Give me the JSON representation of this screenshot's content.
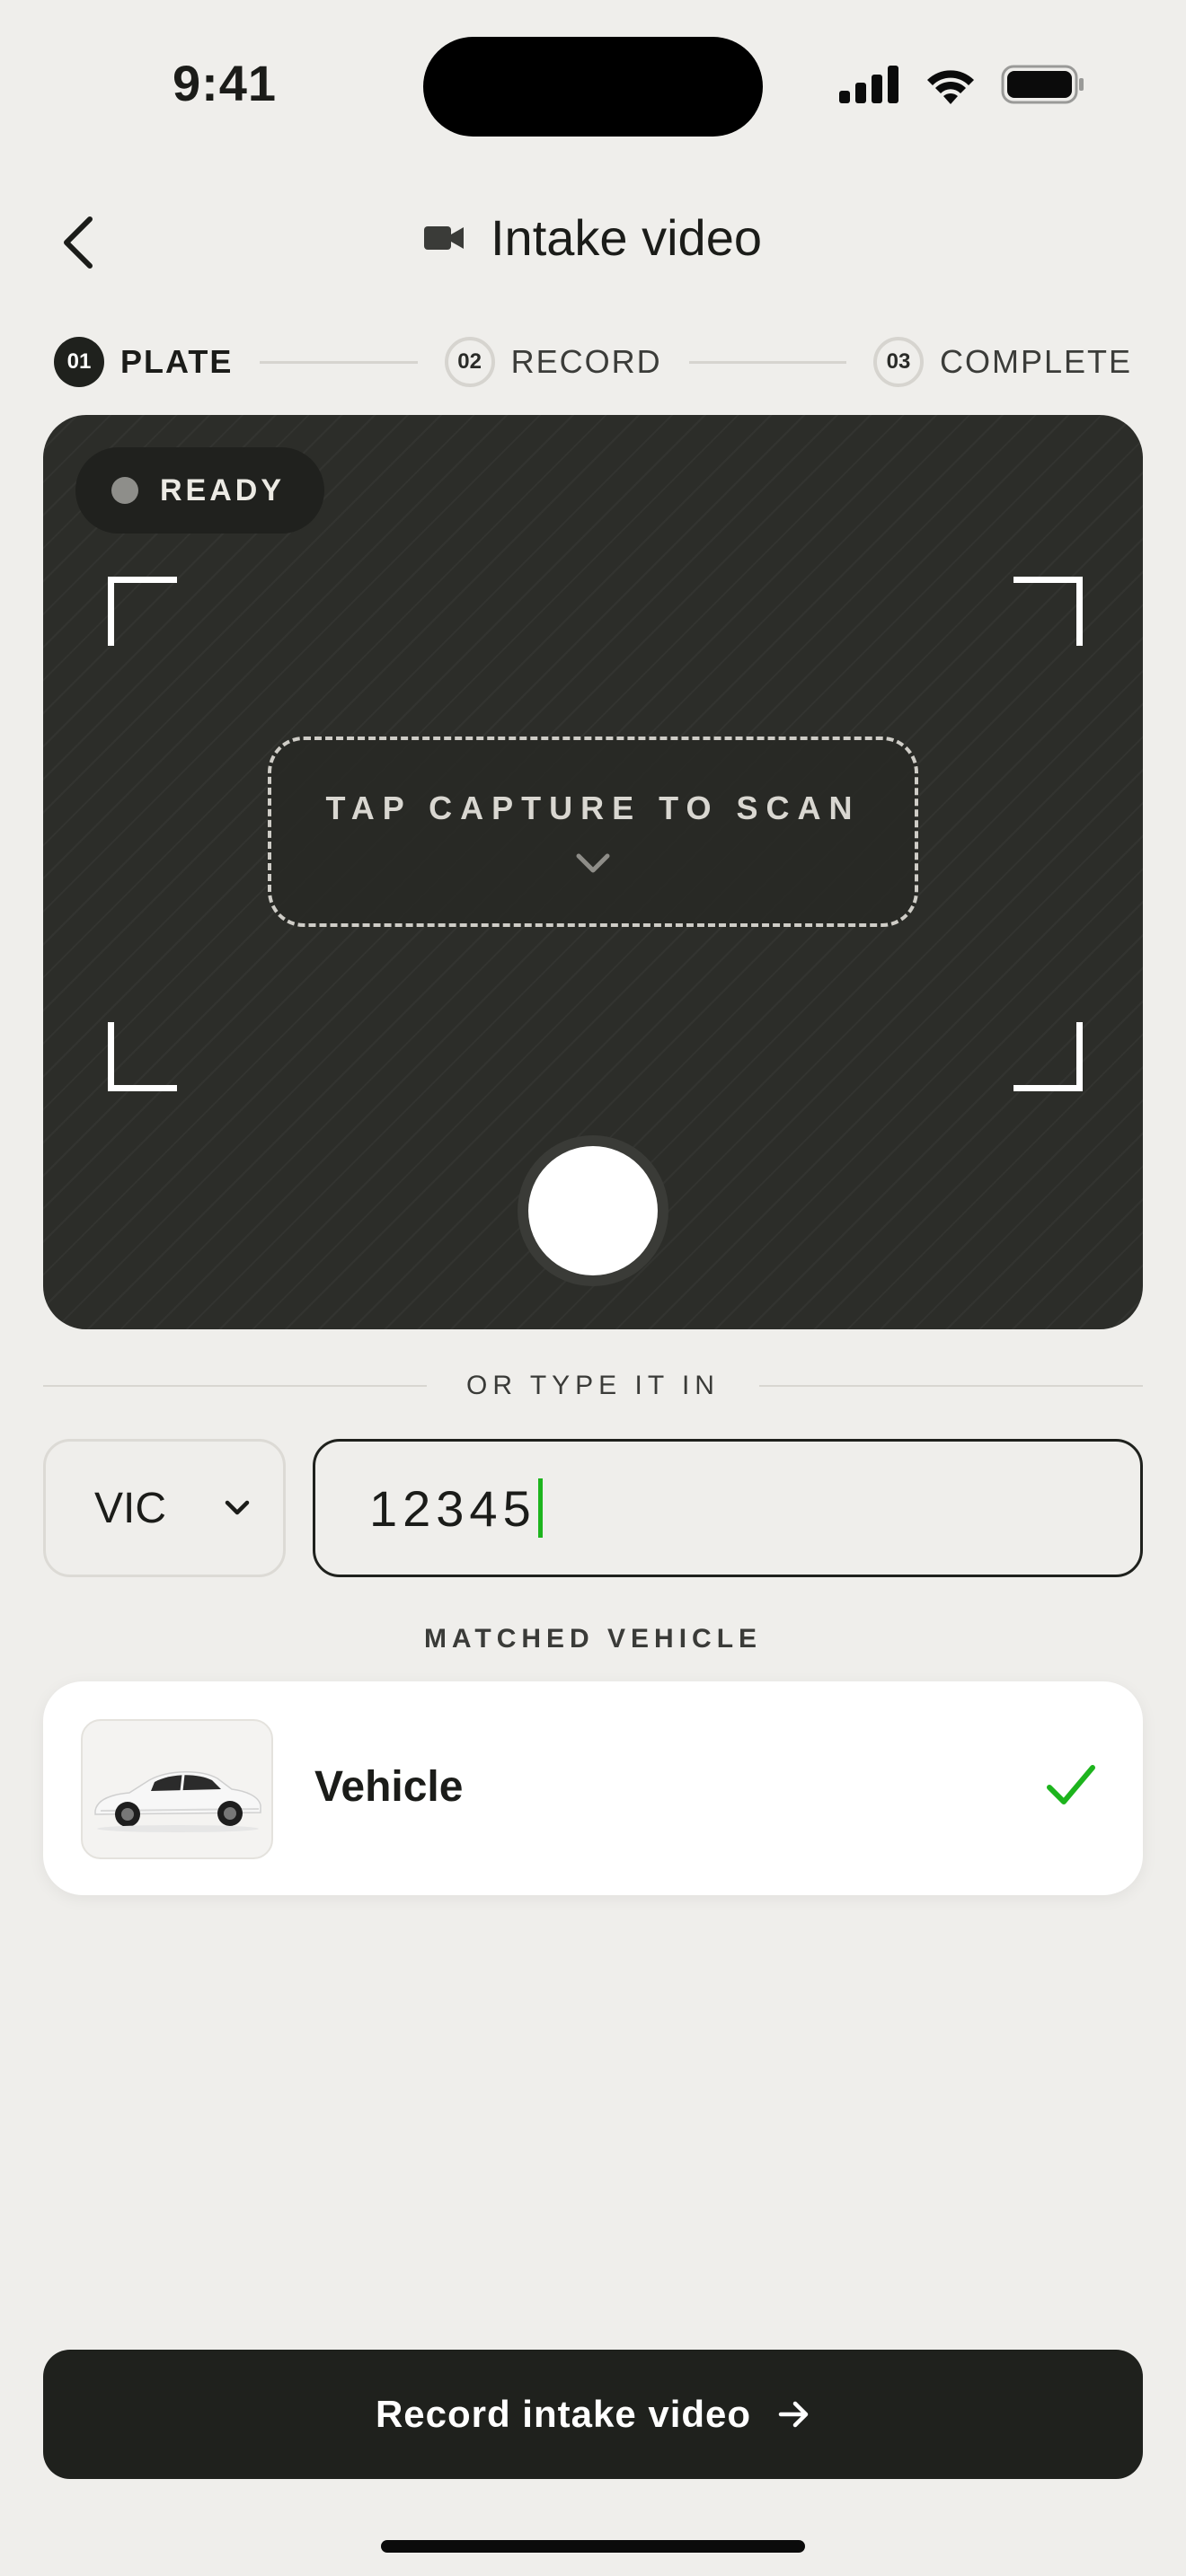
{
  "status_bar": {
    "time": "9:41",
    "icons": [
      "signal-icon",
      "wifi-icon",
      "battery-icon"
    ]
  },
  "nav": {
    "back_icon": "chevron-left-icon",
    "title_icon": "video-camera-icon",
    "title": "Intake video"
  },
  "stepper": {
    "steps": [
      {
        "num": "01",
        "label": "PLATE",
        "state": "active"
      },
      {
        "num": "02",
        "label": "RECORD",
        "state": "inactive"
      },
      {
        "num": "03",
        "label": "COMPLETE",
        "state": "inactive"
      }
    ]
  },
  "camera": {
    "status": "READY",
    "scan_prompt": "TAP CAPTURE TO SCAN",
    "scan_icon": "chevron-down-icon"
  },
  "manual_entry": {
    "divider_label": "OR TYPE IT IN",
    "state": "VIC",
    "plate_value": "12345"
  },
  "matched": {
    "label": "MATCHED VEHICLE",
    "vehicle_name": "Vehicle",
    "status_icon": "check-icon"
  },
  "cta": {
    "label": "Record intake video",
    "icon": "arrow-right-icon"
  },
  "colors": {
    "accent_green": "#1db41d",
    "dark": "#1f211d",
    "background": "#efeeeb"
  }
}
